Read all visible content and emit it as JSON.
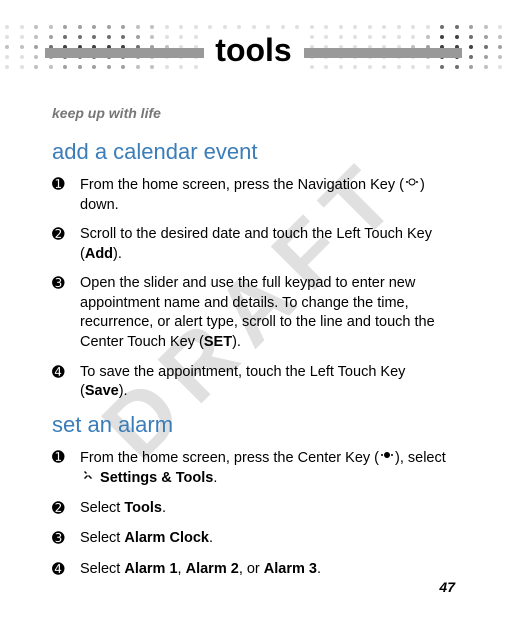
{
  "watermark": "DRAFT",
  "header": {
    "title": "tools",
    "subtitle": "keep up with life"
  },
  "sections": [
    {
      "heading": "add a calendar event",
      "steps": [
        {
          "prefix": "From the home screen, press the Navigation Key (",
          "icon": "nav-key",
          "suffix": ") down."
        },
        {
          "text": "Scroll to the desired date and touch the Left Touch Key (",
          "bold": "Add",
          "suffix": ")."
        },
        {
          "text": "Open the slider and use the full keypad to enter new appointment name and details. To change the time, recurrence, or alert type, scroll to the line and touch the Center Touch Key (",
          "bold": "SET",
          "suffix": ")."
        },
        {
          "text": "To save the appointment, touch the Left Touch Key (",
          "bold": "Save",
          "suffix": ")."
        }
      ]
    },
    {
      "heading": "set an alarm",
      "steps": [
        {
          "prefix": "From the home screen, press the Center Key (",
          "icon": "center-key",
          "mid": "), select ",
          "icon2": "settings",
          "bold": "Settings & Tools",
          "suffix": "."
        },
        {
          "text": "Select ",
          "bold": "Tools",
          "suffix": "."
        },
        {
          "text": "Select ",
          "bold": "Alarm Clock",
          "suffix": "."
        },
        {
          "text": "Select ",
          "bold": "Alarm 1",
          "mid": ", ",
          "bold2": "Alarm 2",
          "mid2": ", or ",
          "bold3": "Alarm 3",
          "suffix": "."
        }
      ]
    }
  ],
  "pageNumber": "47",
  "stepNumbers": [
    "➊",
    "➋",
    "➌",
    "➍"
  ]
}
